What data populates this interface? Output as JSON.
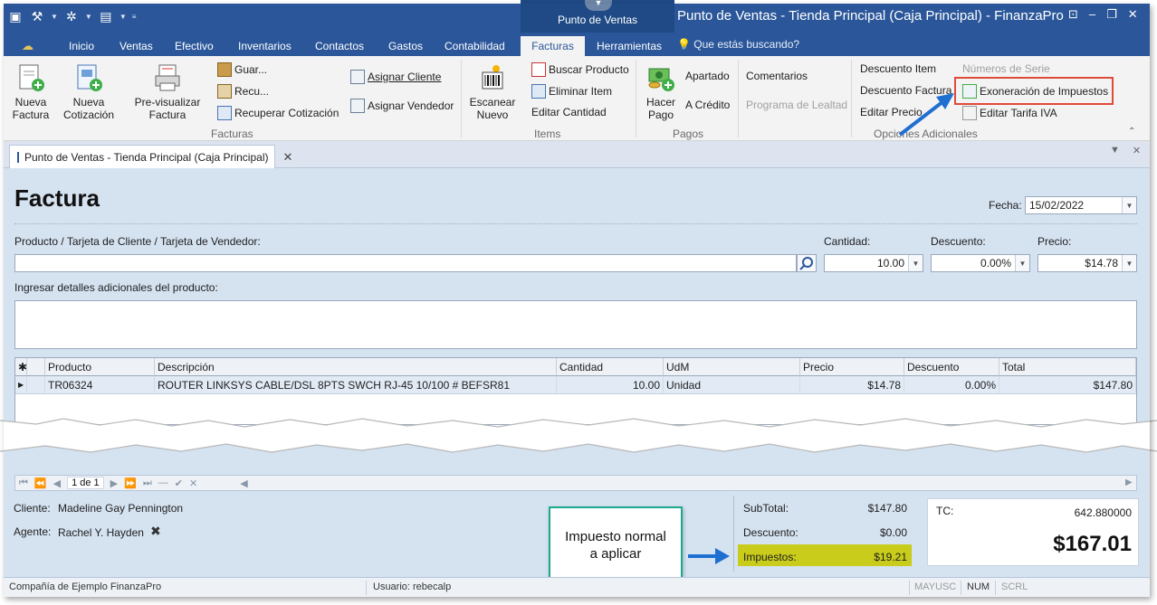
{
  "window": {
    "title": "Punto de Ventas - Tienda Principal (Caja Principal) - FinanzaPro",
    "context_tab": "Punto de Ventas"
  },
  "ribbon_tabs": [
    "Inicio",
    "Ventas",
    "Efectivo",
    "Inventarios",
    "Contactos",
    "Gastos",
    "Contabilidad",
    "Facturas",
    "Herramientas"
  ],
  "active_tab": "Facturas",
  "search_hint": "Que estás buscando?",
  "ribbon": {
    "facturas_group": {
      "label": "Facturas",
      "nueva_factura": [
        "Nueva",
        "Factura"
      ],
      "nueva_cotizacion": [
        "Nueva",
        "Cotización"
      ],
      "previsualizar": [
        "Pre-visualizar",
        "Factura"
      ],
      "guardar": "Guar...",
      "recuperar_short": "Recu...",
      "recuperar_cotizacion": "Recuperar Cotización",
      "asignar_cliente": "Asignar Cliente",
      "asignar_vendedor": "Asignar Vendedor"
    },
    "items_group": {
      "label": "Items",
      "escanear": [
        "Escanear",
        "Nuevo"
      ],
      "buscar_producto": "Buscar Producto",
      "eliminar_item": "Eliminar Item",
      "editar_cantidad": "Editar Cantidad"
    },
    "pagos_group": {
      "label": "Pagos",
      "hacer_pago": [
        "Hacer",
        "Pago"
      ],
      "apartado": "Apartado",
      "a_credito": "A Crédito"
    },
    "opciones_group": {
      "label": "Opciones Adicionales",
      "comentarios": "Comentarios",
      "programa_lealtad": "Programa de Lealtad",
      "descuento_item": "Descuento Item",
      "descuento_factura": "Descuento Factura",
      "editar_precio": "Editar Precio",
      "numeros_serie": "Números de Serie",
      "exoneracion_impuestos": "Exoneración de Impuestos",
      "editar_tarifa_iva": "Editar Tarifa IVA"
    }
  },
  "doc_tab": "Punto de Ventas - Tienda Principal (Caja Principal)",
  "form": {
    "title": "Factura",
    "fecha_label": "Fecha:",
    "fecha_value": "15/02/2022",
    "product_label": "Producto / Tarjeta de Cliente / Tarjeta de Vendedor:",
    "cantidad_label": "Cantidad:",
    "cantidad_value": "10.00",
    "descuento_label": "Descuento:",
    "descuento_value": "0.00%",
    "precio_label": "Precio:",
    "precio_value": "$14.78",
    "details_label": "Ingresar detalles adicionales del producto:"
  },
  "grid": {
    "columns": [
      "Producto",
      "Descripción",
      "Cantidad",
      "UdM",
      "Precio",
      "Descuento",
      "Total"
    ],
    "rows": [
      [
        "TR06324",
        "ROUTER LINKSYS CABLE/DSL 8PTS SWCH RJ-45 10/100 # BEFSR81",
        "10.00",
        "Unidad",
        "$14.78",
        "0.00%",
        "$147.80"
      ]
    ]
  },
  "navigator": {
    "page": "1 de 1"
  },
  "footer": {
    "cliente_label": "Cliente:",
    "cliente_value": "Madeline Gay Pennington",
    "agente_label": "Agente:",
    "agente_value": "Rachel Y. Hayden",
    "subtotal_label": "SubTotal:",
    "subtotal_value": "$147.80",
    "descuento_label": "Descuento:",
    "descuento_value": "$0.00",
    "impuestos_label": "Impuestos:",
    "impuestos_value": "$19.21",
    "tc_label": "TC:",
    "tc_value": "642.880000",
    "total_value": "$167.01"
  },
  "callout": [
    "Impuesto normal",
    "a aplicar"
  ],
  "statusbar": {
    "company": "Compañía de Ejemplo FinanzaPro",
    "user": "Usuario: rebecalp",
    "mayusc": "MAYUSC",
    "num": "NUM",
    "scrl": "SCRL"
  },
  "colors": {
    "title_bar": "#2b579a",
    "highlight_box": "#e04a3b",
    "annotation_arrow": "#1f6fd1",
    "impuestos_highlight": "#c9cc1a",
    "callout_border": "#1ba98f"
  }
}
